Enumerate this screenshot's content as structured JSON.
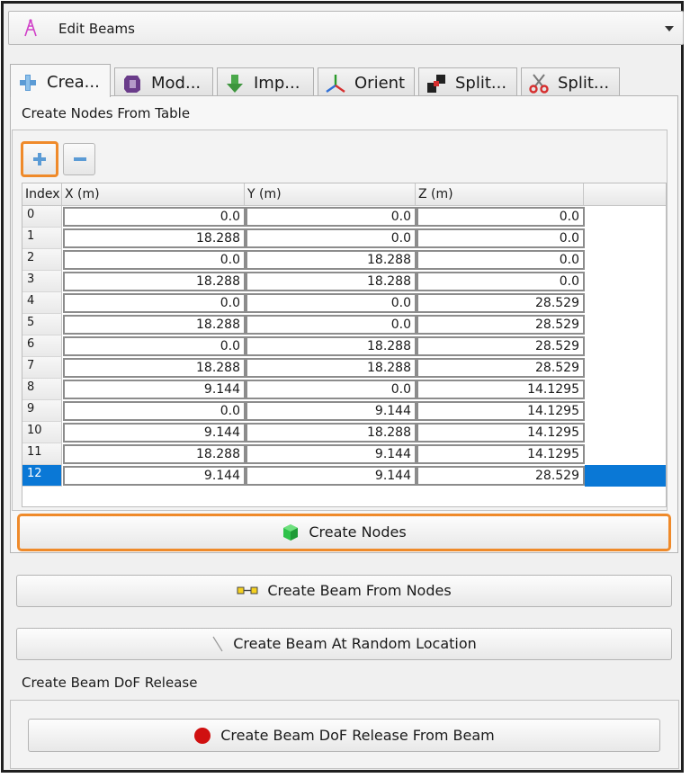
{
  "combo": {
    "title": "Edit Beams",
    "icon": "beam-editor-icon"
  },
  "tabs": [
    {
      "label": "Crea...",
      "icon": "plus-icon",
      "active": true
    },
    {
      "label": "Mod...",
      "icon": "modify-icon"
    },
    {
      "label": "Imp...",
      "icon": "import-icon"
    },
    {
      "label": "Orient",
      "icon": "axes-icon"
    },
    {
      "label": "Split...",
      "icon": "split-icon"
    },
    {
      "label": "Split...",
      "icon": "scissors-icon"
    }
  ],
  "section_title": "Create Nodes From Table",
  "toolbar": {
    "add_icon": "plus-icon",
    "remove_icon": "minus-icon"
  },
  "table": {
    "headers": [
      "Index",
      "X (m)",
      "Y (m)",
      "Z (m)"
    ],
    "rows": [
      {
        "index": "0",
        "x": "0.0",
        "y": "0.0",
        "z": "0.0"
      },
      {
        "index": "1",
        "x": "18.288",
        "y": "0.0",
        "z": "0.0"
      },
      {
        "index": "2",
        "x": "0.0",
        "y": "18.288",
        "z": "0.0"
      },
      {
        "index": "3",
        "x": "18.288",
        "y": "18.288",
        "z": "0.0"
      },
      {
        "index": "4",
        "x": "0.0",
        "y": "0.0",
        "z": "28.529"
      },
      {
        "index": "5",
        "x": "18.288",
        "y": "0.0",
        "z": "28.529"
      },
      {
        "index": "6",
        "x": "0.0",
        "y": "18.288",
        "z": "28.529"
      },
      {
        "index": "7",
        "x": "18.288",
        "y": "18.288",
        "z": "28.529"
      },
      {
        "index": "8",
        "x": "9.144",
        "y": "0.0",
        "z": "14.1295"
      },
      {
        "index": "9",
        "x": "0.0",
        "y": "9.144",
        "z": "14.1295"
      },
      {
        "index": "10",
        "x": "9.144",
        "y": "18.288",
        "z": "14.1295"
      },
      {
        "index": "11",
        "x": "18.288",
        "y": "9.144",
        "z": "14.1295"
      },
      {
        "index": "12",
        "x": "9.144",
        "y": "9.144",
        "z": "28.529"
      }
    ],
    "selected_row": "12"
  },
  "buttons": {
    "create_nodes": "Create Nodes",
    "create_beam_from_nodes": "Create Beam From Nodes",
    "create_beam_random": "Create Beam At Random Location",
    "create_dof_release": "Create Beam DoF Release From Beam"
  },
  "dof_section_title": "Create Beam DoF Release",
  "colors": {
    "highlight": "#ef8a2a",
    "selection": "#0a78d6",
    "cube": "#2fc24a",
    "dot": "#d01010"
  }
}
